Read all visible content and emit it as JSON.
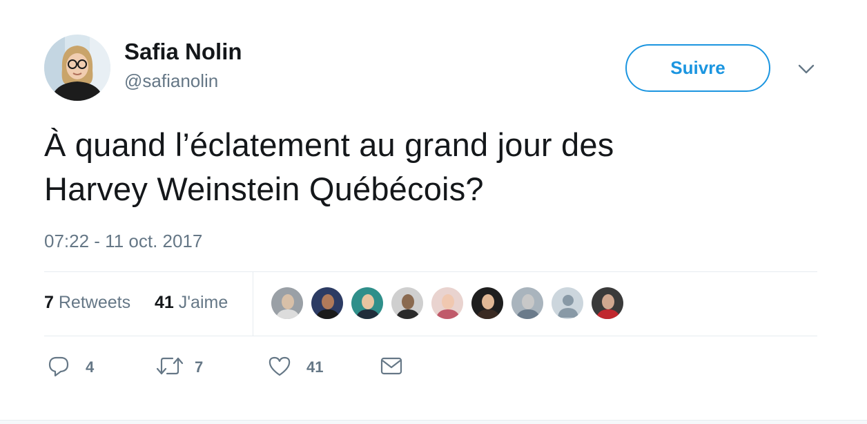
{
  "user": {
    "name": "Safia Nolin",
    "handle": "@safianolin"
  },
  "follow_button": {
    "label": "Suivre"
  },
  "menu_icon": "chevron-down-icon",
  "tweet": {
    "line1": "À quand l’éclatement au grand jour des",
    "line2": "Harvey Weinstein Québécois?",
    "timestamp": "07:22 - 11 oct. 2017"
  },
  "stats": {
    "retweets": {
      "count": "7",
      "label": "Retweets"
    },
    "likes": {
      "count": "41",
      "label": "J'aime"
    }
  },
  "likers": [
    {
      "icon": "liker-avatar-1",
      "bg": "#9aa0a6",
      "skin": "#d8c0a8",
      "shirt": "#dcdcdc"
    },
    {
      "icon": "liker-avatar-2",
      "bg": "#2c3b63",
      "skin": "#b07a5a",
      "shirt": "#1a1a1a"
    },
    {
      "icon": "liker-avatar-3",
      "bg": "#2f8f8a",
      "skin": "#e8c4a0",
      "shirt": "#1f2d3a"
    },
    {
      "icon": "liker-avatar-4",
      "bg": "#cfcfcf",
      "skin": "#8a6a50",
      "shirt": "#2a2a2a"
    },
    {
      "icon": "liker-avatar-5",
      "bg": "#e9d3cf",
      "skin": "#f0c8b0",
      "shirt": "#c05a6a"
    },
    {
      "icon": "liker-avatar-6",
      "bg": "#1e1e1e",
      "skin": "#e0b896",
      "shirt": "#3a2a22"
    },
    {
      "icon": "liker-avatar-7",
      "bg": "#a9b4bd",
      "skin": "#c8c8c8",
      "shirt": "#6a7a8a"
    },
    {
      "icon": "default-avatar-icon",
      "bg": "#ccd6dd",
      "skin": "#8899a6",
      "shirt": "#8899a6"
    },
    {
      "icon": "liker-avatar-9",
      "bg": "#3a3a3a",
      "skin": "#d0a890",
      "shirt": "#c0282e"
    }
  ],
  "actions": {
    "reply": {
      "icon": "reply-icon",
      "count": "4"
    },
    "retweet": {
      "icon": "retweet-icon",
      "count": "7"
    },
    "like": {
      "icon": "heart-icon",
      "count": "41"
    },
    "message": {
      "icon": "envelope-icon"
    }
  },
  "colors": {
    "accent": "#1b95e0",
    "secondary_text": "#657786",
    "primary_text": "#14171a",
    "border": "#e6ecf0"
  }
}
